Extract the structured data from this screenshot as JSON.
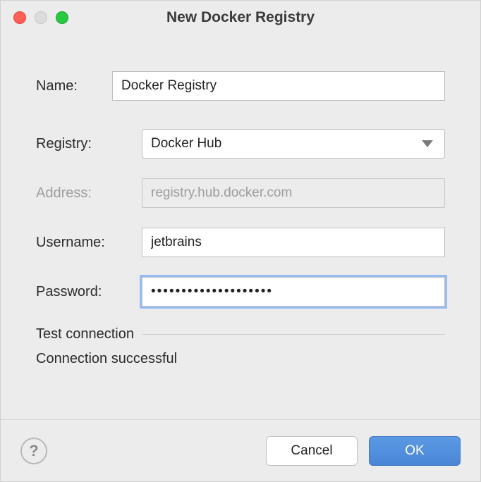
{
  "window": {
    "title": "New Docker Registry"
  },
  "form": {
    "name": {
      "label": "Name:",
      "value": "Docker Registry"
    },
    "registry": {
      "label": "Registry:",
      "selected": "Docker Hub"
    },
    "address": {
      "label": "Address:",
      "value": "registry.hub.docker.com"
    },
    "username": {
      "label": "Username:",
      "value": "jetbrains"
    },
    "password": {
      "label": "Password:",
      "mask": "••••••••••••••••••••"
    }
  },
  "test": {
    "link": "Test connection",
    "status": "Connection successful"
  },
  "footer": {
    "help": "?",
    "cancel": "Cancel",
    "ok": "OK"
  }
}
